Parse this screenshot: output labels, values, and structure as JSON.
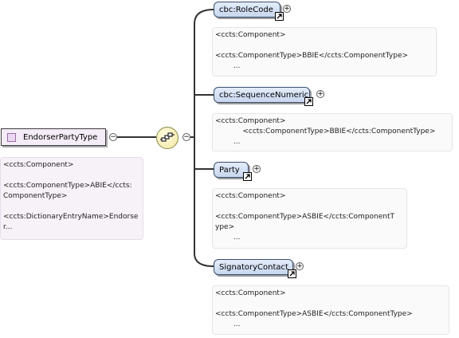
{
  "root": {
    "label": "EndorserPartyType",
    "annotation": "<ccts:Component>\n\n<ccts:ComponentType>ABIE</ccts:\nComponentType>\n\n<ccts:DictionaryEntryName>Endorse\nr..."
  },
  "children": [
    {
      "label": "cbc:RoleCode",
      "annotation": "<ccts:Component>\n\n<ccts:ComponentType>BBIE</ccts:ComponentType>\n        ..."
    },
    {
      "label": "cbc:SequenceNumeric",
      "annotation": "<ccts:Component>\n            <ccts:ComponentType>BBIE</ccts:ComponentType>\n        ..."
    },
    {
      "label": "Party",
      "annotation": "<ccts:Component>\n\n<ccts:ComponentType>ASBIE</ccts:ComponentT\nype>\n        ..."
    },
    {
      "label": "SignatoryContact",
      "annotation": "<ccts:Component>\n\n<ccts:ComponentType>ASBIE</ccts:ComponentType>\n        ..."
    }
  ],
  "icons": {
    "root_type": "complex-type-icon",
    "expand": "plus-circle-icon",
    "collapse": "minus-circle-icon",
    "sequence": "sequence-compositor-icon",
    "reference": "reference-arrow-icon"
  },
  "colors": {
    "root_fill": "#f4ecf7",
    "child_fill": "#d5e1f4",
    "compositor_fill": "#f2e7a0"
  }
}
